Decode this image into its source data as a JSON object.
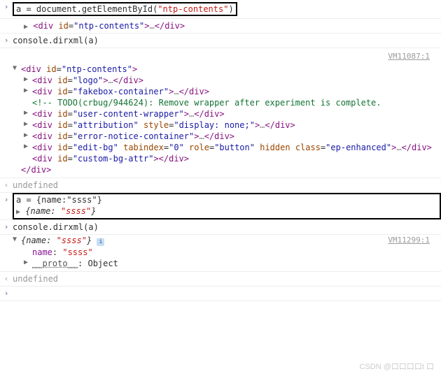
{
  "line1": {
    "code_pre": "a = document.getElementById(",
    "code_arg": "\"ntp-contents\"",
    "code_post": ")"
  },
  "line2": {
    "tag": "div",
    "idval": "ntp-contents",
    "ellipsis": "…"
  },
  "line3": {
    "code": "console.dirxml(a)"
  },
  "vm1": "VM11087:1",
  "tree": {
    "root": {
      "tag": "div",
      "id": "ntp-contents"
    },
    "children": [
      {
        "tag": "div",
        "attrs": [
          [
            "id",
            "logo"
          ]
        ],
        "ellipsis": "…"
      },
      {
        "tag": "div",
        "attrs": [
          [
            "id",
            "fakebox-container"
          ]
        ],
        "ellipsis": "…"
      },
      {
        "comment": "<!-- TODO(crbug/944624): Remove wrapper after experiment is complete."
      },
      {
        "tag": "div",
        "attrs": [
          [
            "id",
            "user-content-wrapper"
          ]
        ],
        "ellipsis": "…"
      },
      {
        "tag": "div",
        "attrs": [
          [
            "id",
            "attribution"
          ],
          [
            "style",
            "display: none;"
          ]
        ],
        "ellipsis": "…"
      },
      {
        "tag": "div",
        "attrs": [
          [
            "id",
            "error-notice-container"
          ]
        ],
        "ellipsis": "…"
      },
      {
        "tag": "div",
        "attrs": [
          [
            "id",
            "edit-bg"
          ],
          [
            "tabindex",
            "0"
          ],
          [
            "role",
            "button"
          ],
          [
            "hidden",
            null
          ],
          [
            "class",
            "ep-enhanced"
          ]
        ],
        "ellipsis": "…"
      },
      {
        "tag": "div",
        "attrs": [
          [
            "id",
            "custom-bg-attr"
          ]
        ],
        "ellipsis": null
      }
    ]
  },
  "undef": "undefined",
  "line5": {
    "code": "a = {name:\"ssss\"}"
  },
  "line6": {
    "obj_open": "{name: ",
    "obj_val": "\"ssss\"",
    "obj_close": "}"
  },
  "line7": {
    "code": "console.dirxml(a)"
  },
  "vm2": "VM11299:1",
  "expand": {
    "head_open": "{name: ",
    "head_val": "\"ssss\"",
    "head_close": "}",
    "key1": "name",
    "val1": "\"ssss\"",
    "proto_label": "__proto__",
    "proto_val": "Object"
  },
  "watermark": "CSDN @口口口口t 口"
}
